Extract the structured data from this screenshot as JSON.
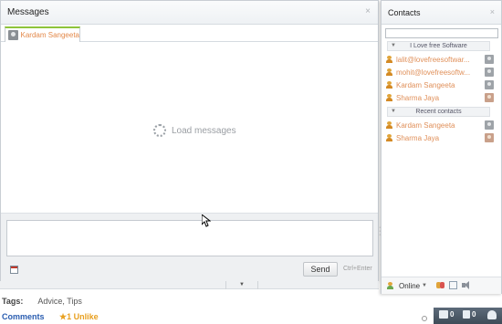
{
  "page": {
    "tags_label": "Tags:",
    "tags_values": "Advice, Tips",
    "comments_link": "Comments",
    "unlike_text": "★1 Unlike"
  },
  "messages_window": {
    "title": "Messages",
    "close_icon": "×",
    "active_tab": {
      "name": "Kardam Sangeeta"
    },
    "loading_text": "Load messages",
    "send_label": "Send",
    "send_hint": "Ctrl+Enter"
  },
  "contacts": {
    "title": "Contacts",
    "close_icon": "×",
    "search_placeholder": "",
    "groups": [
      {
        "name": "I Love free Software",
        "items": [
          {
            "name": "lalit@lovefreesoftwar...",
            "avatar": "default"
          },
          {
            "name": "mohit@lovefreesoftw...",
            "avatar": "default"
          },
          {
            "name": "Kardam Sangeeta",
            "avatar": "default"
          },
          {
            "name": "Sharma Jaya",
            "avatar": "photo"
          }
        ]
      },
      {
        "name": "Recent contacts",
        "items": [
          {
            "name": "Kardam Sangeeta",
            "avatar": "default"
          },
          {
            "name": "Sharma Jaya",
            "avatar": "photo"
          }
        ]
      }
    ],
    "status": "Online"
  },
  "bottom_bar": {
    "chat_count": "0",
    "alert_count": "0"
  },
  "colors": {
    "accent_green": "#8ec43a",
    "contact_name_color": "#e0905a",
    "link_blue": "#2a5db0",
    "bar_dark": "#3f4b58"
  },
  "icons": [
    "close-icon",
    "user-avatar-icon",
    "spinner-icon",
    "calendar-icon",
    "person-icon",
    "group-icon",
    "list-icon",
    "sound-icon",
    "chat-icon",
    "alert-icon",
    "contacts-icon"
  ]
}
